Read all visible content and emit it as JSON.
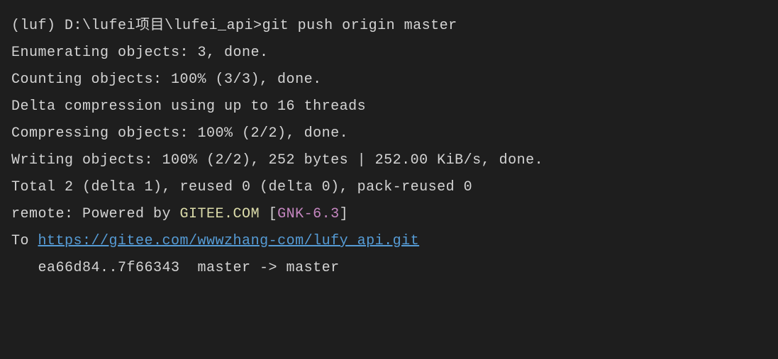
{
  "prompt": {
    "env": "(luf) ",
    "path": "D:\\lufei项目\\lufei_api>",
    "command": "git push origin master"
  },
  "output": {
    "line1": "Enumerating objects: 3, done.",
    "line2": "Counting objects: 100% (3/3), done.",
    "line3": "Delta compression using up to 16 threads",
    "line4": "Compressing objects: 100% (2/2), done.",
    "line5": "Writing objects: 100% (2/2), 252 bytes | 252.00 KiB/s, done.",
    "line6": "Total 2 (delta 1), reused 0 (delta 0), pack-reused 0",
    "remote_prefix": "remote: Powered by ",
    "remote_gitee": "GITEE.COM",
    "remote_bracket_open": " [",
    "remote_gnk": "GNK-6.3",
    "remote_bracket_close": "]",
    "to_prefix": "To ",
    "to_url": "https://gitee.com/wwwzhang-com/lufy_api.git",
    "ref_line": "   ea66d84..7f66343  master -> master"
  }
}
